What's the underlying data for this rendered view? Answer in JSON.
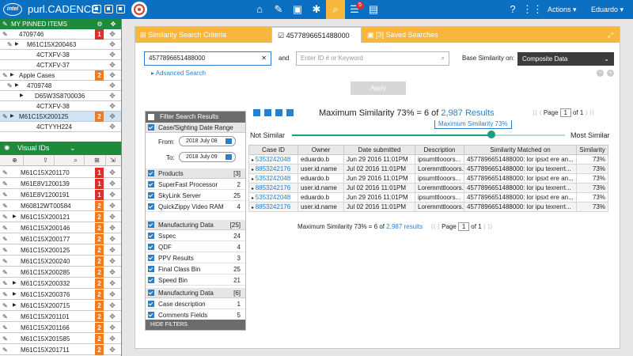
{
  "app": {
    "title": "purl.CADENCE",
    "logo_text": "intel",
    "actions_label": "Actions",
    "user_name": "Eduardo"
  },
  "nav": {
    "notification_count": "5"
  },
  "sidebar": {
    "pinned_title": "MY PINNED ITEMS",
    "pinned_rows": [
      {
        "label": "4709746",
        "count": "1",
        "count_color": "red"
      },
      {
        "label": "M61C15X200463",
        "count": "",
        "count_color": ""
      },
      {
        "label": "4CTXFV-38",
        "count": "",
        "count_color": ""
      },
      {
        "label": "4CTXFV-37",
        "count": "",
        "count_color": ""
      },
      {
        "label": "Apple Cases",
        "count": "2",
        "count_color": "orange"
      },
      {
        "label": "4709748",
        "count": "",
        "count_color": ""
      },
      {
        "label": "D65W3S8700036",
        "count": "",
        "count_color": ""
      },
      {
        "label": "4CTXFV-38",
        "count": "",
        "count_color": ""
      },
      {
        "label": "M61C15X200125",
        "count": "2",
        "count_color": "orange"
      },
      {
        "label": "4CTYYH224",
        "count": "",
        "count_color": ""
      }
    ],
    "visual_ids_title": "Visual IDs",
    "visual_ids": [
      {
        "label": "M61C15X201170",
        "count": "1",
        "count_color": "red"
      },
      {
        "label": "M61E8V1200139",
        "count": "1",
        "count_color": "red"
      },
      {
        "label": "M61E8V1200191",
        "count": "1",
        "count_color": "red"
      },
      {
        "label": "M60812WT00584",
        "count": "2",
        "count_color": "orange"
      },
      {
        "label": "M61C15X200121",
        "count": "2",
        "count_color": "orange"
      },
      {
        "label": "M61C15X200146",
        "count": "2",
        "count_color": "orange"
      },
      {
        "label": "M61C15X200177",
        "count": "2",
        "count_color": "orange"
      },
      {
        "label": "M61C15X200125",
        "count": "2",
        "count_color": "orange"
      },
      {
        "label": "M61C15X200240",
        "count": "2",
        "count_color": "orange"
      },
      {
        "label": "M61C15X200285",
        "count": "2",
        "count_color": "orange"
      },
      {
        "label": "M61C15X200332",
        "count": "2",
        "count_color": "orange"
      },
      {
        "label": "M61C15X200376",
        "count": "2",
        "count_color": "orange"
      },
      {
        "label": "M61C15X200715",
        "count": "2",
        "count_color": "orange"
      },
      {
        "label": "M61C15X201101",
        "count": "2",
        "count_color": "orange"
      },
      {
        "label": "M61C15X201166",
        "count": "2",
        "count_color": "orange"
      },
      {
        "label": "M61C15X201585",
        "count": "2",
        "count_color": "orange"
      },
      {
        "label": "M61C15X201711",
        "count": "2",
        "count_color": "orange"
      }
    ]
  },
  "main": {
    "tabs": {
      "criteria": "Similarity Search Criteria",
      "active": "4577896651488000",
      "saved": "[3] Saved Searches"
    },
    "search": {
      "id_value": "4577896651488000",
      "and_label": "and",
      "keyword_placeholder": "Enter ID # or Keyword",
      "base_label": "Base Similarity on:",
      "base_value": "Composite Data",
      "advanced_label": "Advanced Search",
      "apply_label": "Apply"
    },
    "filter": {
      "title": "Filter Search Results",
      "case_date_label": "Case/Sighting Date Range",
      "from_label": "From:",
      "from_value": "2018 July 08",
      "to_label": "To:",
      "to_value": "2018 July 09",
      "products_label": "Products",
      "products_count": "[3]",
      "products": [
        {
          "label": "SuperFast Processor",
          "count": "2"
        },
        {
          "label": "SkyLink Server",
          "count": "25"
        },
        {
          "label": "QuickZippy Video RAM",
          "count": "4"
        }
      ],
      "mfg_label": "Manufacturing Data",
      "mfg_count": "[25]",
      "mfg": [
        {
          "label": "Sspec",
          "count": "24"
        },
        {
          "label": "QDF",
          "count": "4"
        },
        {
          "label": "PPV Results",
          "count": "3"
        },
        {
          "label": "Final Class Bin",
          "count": "25"
        },
        {
          "label": "Speed Bin",
          "count": "21"
        }
      ],
      "mfg2_label": "Manufacturing Data",
      "mfg2_count": "[6]",
      "mfg2": [
        {
          "label": "Case description",
          "count": "1"
        },
        {
          "label": "Comments Fields",
          "count": "5"
        }
      ],
      "hide_label": "HIDE FILTERS"
    },
    "results": {
      "title_prefix": "Maximum Similarity 73% = 6 of",
      "total_link": "2,987 Results",
      "page_label": "Page",
      "page_value": "1",
      "of_label": "of 1",
      "not_similar": "Not Similar",
      "most_similar": "Most Similar",
      "tooltip": "Maximum Similarity 73%",
      "slider_fraction": 0.73,
      "columns": [
        "Case ID",
        "Owner",
        "Date submitted",
        "Description",
        "Similarity Matched on",
        "Similarity"
      ],
      "rows": [
        [
          "5353242048",
          "eduardo.b",
          "Jun 29 2016 11:01PM",
          "ipsumttlooors...",
          "4577896651488000: lor ipsxt ere an...",
          "73%"
        ],
        [
          "8853242176",
          "user.id.name",
          "Jul 02 2016 11:01PM",
          "Loremmttlooors...",
          "4577896651488000: lor ipu texrerrt...",
          "73%"
        ],
        [
          "5353242048",
          "eduardo.b",
          "Jun 29 2016 11:01PM",
          "ipsumttlooors...",
          "4577896651488000: lor ipsxt ere an...",
          "73%"
        ],
        [
          "8853242176",
          "user.id.name",
          "Jul 02 2016 11:01PM",
          "Loremmttlooors...",
          "4577896651488000: lor ipu texrerrt...",
          "73%"
        ],
        [
          "5353242048",
          "eduardo.b",
          "Jun 29 2016 11:01PM",
          "ipsumttlooors...",
          "4577896651488000: lor ipsxt ere an...",
          "73%"
        ],
        [
          "8853242176",
          "user.id.name",
          "Jul 02 2016 11:01PM",
          "Loremmttlooors...",
          "4577896651488000: lor ipu texrerrt...",
          "73%"
        ]
      ],
      "bottom_prefix": "Maximum Similarity 73% = 6 of",
      "bottom_link": "2,987 results"
    }
  }
}
